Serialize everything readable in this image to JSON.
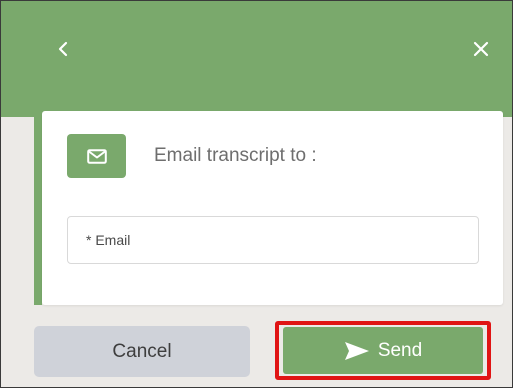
{
  "header": {
    "back_icon": "chevron-left-icon",
    "close_icon": "close-icon"
  },
  "card": {
    "icon": "envelope-icon",
    "title": "Email transcript to :",
    "email_placeholder": "* Email",
    "email_value": ""
  },
  "actions": {
    "cancel_label": "Cancel",
    "send_label": "Send",
    "send_icon": "paper-plane-icon"
  },
  "colors": {
    "brand_green": "#7aa96c",
    "highlight_red": "#e01414",
    "cancel_gray": "#cfd2d9",
    "panel_bg": "#eceae7"
  }
}
